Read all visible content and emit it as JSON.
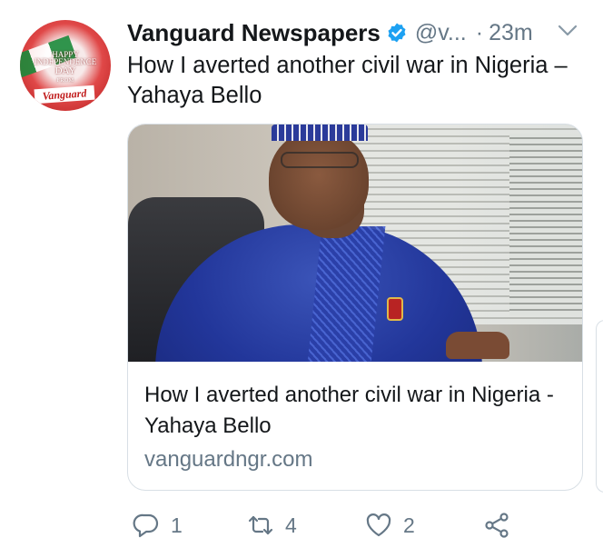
{
  "account": {
    "name": "Vanguard Newspapers",
    "handle": "@v...",
    "separator": "·",
    "time": "23m",
    "verified": true,
    "avatar_text": [
      "HAPPY",
      "INDEPENDENCE",
      "DAY",
      "FROM",
      "Vanguard"
    ]
  },
  "tweet": {
    "text": "How I averted another civil war in Nigeria – Yahaya Bello"
  },
  "card": {
    "title": "How I averted another civil war in Nigeria - Yahaya Bello",
    "domain": "vanguardngr.com"
  },
  "actions": {
    "replies": "1",
    "retweets": "4",
    "likes": "2"
  },
  "icons": {
    "verified": "verified-badge-icon",
    "caret": "chevron-down-icon",
    "reply": "reply-icon",
    "retweet": "retweet-icon",
    "like": "heart-icon",
    "share": "share-icon"
  },
  "colors": {
    "accent": "#1da1f2",
    "secondary_text": "#657786",
    "primary_text": "#14171a",
    "border": "#d8dfe5"
  }
}
